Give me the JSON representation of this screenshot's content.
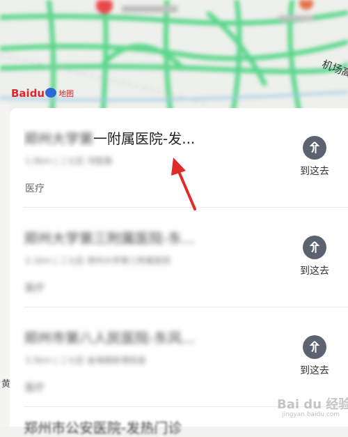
{
  "map": {
    "road_label": "机场高",
    "logo_text": "Baidu",
    "logo_map_word": "地图"
  },
  "results": [
    {
      "title_blurred": "郑州大学第",
      "title_visible": "一附属医院-发...",
      "subtitle": "1.0km | 二七区 河医路",
      "category": "医疗",
      "action_label": "到这去"
    },
    {
      "title_blurred": "郑州大学第三附属医院-东...",
      "title_visible": "",
      "subtitle": "2.1km | 二七区 郑州大学第三附属医院",
      "category": "医疗",
      "action_label": "到这去"
    },
    {
      "title_blurred": "郑州市第八人民医院-东风...",
      "title_visible": "",
      "subtitle": "3.5km | 二七区 金海路新港街道",
      "category": "医疗",
      "action_label": "到这去"
    }
  ],
  "partial_next_title": "郑州市公安医院-发热门诊",
  "left_edge_char": "黄",
  "watermark": {
    "text": "Bai du 经验",
    "sub": "jingyan.baidu.com"
  },
  "colors": {
    "road_green": "#4ccf7e",
    "annotation_arrow": "#e02b2b",
    "nav_icon": "#5b6270",
    "baidu_red": "#e0242b"
  }
}
